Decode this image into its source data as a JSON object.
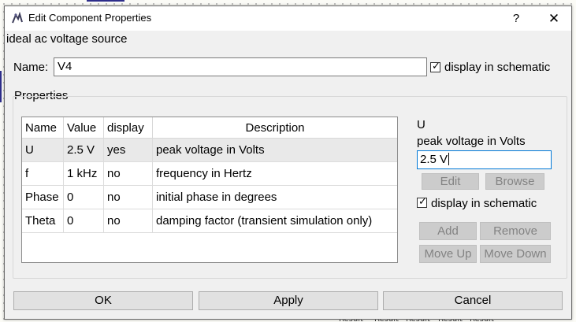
{
  "window": {
    "title": "Edit Component Properties",
    "help_glyph": "?",
    "close_glyph": "✕"
  },
  "component": {
    "description": "ideal ac voltage source",
    "name_label": "Name:",
    "name_value": "V4",
    "display_in_schematic_label": "display in schematic",
    "display_in_schematic_checked": true
  },
  "properties": {
    "group_label": "Properties",
    "columns": [
      "Name",
      "Value",
      "display",
      "Description"
    ],
    "rows": [
      {
        "name": "U",
        "value": "2.5 V",
        "display": "yes",
        "description": "peak voltage in Volts",
        "selected": true
      },
      {
        "name": "f",
        "value": "1 kHz",
        "display": "no",
        "description": "frequency in Hertz",
        "selected": false
      },
      {
        "name": "Phase",
        "value": "0",
        "display": "no",
        "description": "initial phase in degrees",
        "selected": false
      },
      {
        "name": "Theta",
        "value": "0",
        "display": "no",
        "description": "damping factor (transient simulation only)",
        "selected": false
      }
    ]
  },
  "editor": {
    "property_name": "U",
    "property_description": "peak voltage in Volts",
    "value": "2.5 V",
    "edit_label": "Edit",
    "browse_label": "Browse",
    "display_in_schematic_label": "display in schematic",
    "display_in_schematic_checked": true,
    "add_label": "Add",
    "remove_label": "Remove",
    "move_up_label": "Move Up",
    "move_down_label": "Move Down"
  },
  "footer": {
    "ok_label": "OK",
    "apply_label": "Apply",
    "cancel_label": "Cancel"
  },
  "background_labels": [
    "Result",
    "Result",
    "Result",
    "Result",
    "Result"
  ],
  "colors": {
    "accent_focus": "#0078d7",
    "selected_row": "#e9e9e9",
    "wire": "#2d2d8a"
  },
  "icons": {
    "app": "qucs-app-icon",
    "help": "help-icon",
    "close": "close-icon",
    "check": "checkmark-icon"
  }
}
